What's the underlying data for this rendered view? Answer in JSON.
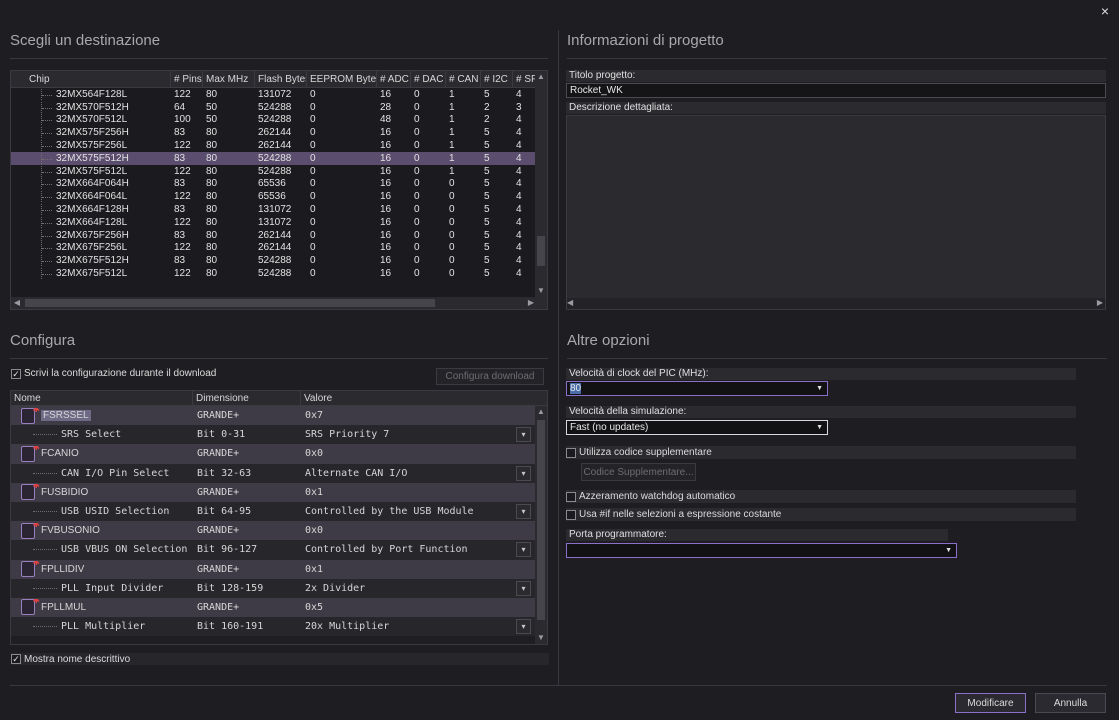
{
  "window": {
    "close_glyph": "×"
  },
  "destination": {
    "title": "Scegli un destinazione",
    "columns": [
      "Chip",
      "# Pins",
      "Max MHz",
      "Flash Bytes",
      "EEPROM Bytes",
      "# ADC",
      "# DAC",
      "# CAN",
      "# I2C",
      "# SP"
    ],
    "rows": [
      [
        "32MX564F128L",
        "122",
        "80",
        "131072",
        "0",
        "16",
        "0",
        "1",
        "5",
        "4"
      ],
      [
        "32MX570F512H",
        "64",
        "50",
        "524288",
        "0",
        "28",
        "0",
        "1",
        "2",
        "3"
      ],
      [
        "32MX570F512L",
        "100",
        "50",
        "524288",
        "0",
        "48",
        "0",
        "1",
        "2",
        "4"
      ],
      [
        "32MX575F256H",
        "83",
        "80",
        "262144",
        "0",
        "16",
        "0",
        "1",
        "5",
        "4"
      ],
      [
        "32MX575F256L",
        "122",
        "80",
        "262144",
        "0",
        "16",
        "0",
        "1",
        "5",
        "4"
      ],
      [
        "32MX575F512H",
        "83",
        "80",
        "524288",
        "0",
        "16",
        "0",
        "1",
        "5",
        "4"
      ],
      [
        "32MX575F512L",
        "122",
        "80",
        "524288",
        "0",
        "16",
        "0",
        "1",
        "5",
        "4"
      ],
      [
        "32MX664F064H",
        "83",
        "80",
        "65536",
        "0",
        "16",
        "0",
        "0",
        "5",
        "4"
      ],
      [
        "32MX664F064L",
        "122",
        "80",
        "65536",
        "0",
        "16",
        "0",
        "0",
        "5",
        "4"
      ],
      [
        "32MX664F128H",
        "83",
        "80",
        "131072",
        "0",
        "16",
        "0",
        "0",
        "5",
        "4"
      ],
      [
        "32MX664F128L",
        "122",
        "80",
        "131072",
        "0",
        "16",
        "0",
        "0",
        "5",
        "4"
      ],
      [
        "32MX675F256H",
        "83",
        "80",
        "262144",
        "0",
        "16",
        "0",
        "0",
        "5",
        "4"
      ],
      [
        "32MX675F256L",
        "122",
        "80",
        "262144",
        "0",
        "16",
        "0",
        "0",
        "5",
        "4"
      ],
      [
        "32MX675F512H",
        "83",
        "80",
        "524288",
        "0",
        "16",
        "0",
        "0",
        "5",
        "4"
      ],
      [
        "32MX675F512L",
        "122",
        "80",
        "524288",
        "0",
        "16",
        "0",
        "0",
        "5",
        "4"
      ]
    ],
    "selected_row": 5
  },
  "project_info": {
    "title": "Informazioni di progetto",
    "project_title_label": "Titolo progetto:",
    "project_title_value": "Rocket_WK",
    "description_label": "Descrizione dettagliata:",
    "description_value": ""
  },
  "configure": {
    "title": "Configura",
    "write_config_label": "Scrivi la configurazione durante il download",
    "write_config_checked": true,
    "config_download_button": "Configura download",
    "columns": [
      "Nome",
      "Dimensione",
      "Valore"
    ],
    "rows": [
      {
        "type": "reg",
        "name": "FSRSSEL",
        "size": "GRANDE+",
        "value": "0x7"
      },
      {
        "type": "field",
        "name": "SRS Select",
        "size": "Bit 0-31",
        "value": "SRS Priority 7"
      },
      {
        "type": "reg",
        "name": "FCANIO",
        "size": "GRANDE+",
        "value": "0x0"
      },
      {
        "type": "field",
        "name": "CAN I/O Pin Select",
        "size": "Bit 32-63",
        "value": "Alternate CAN I/O"
      },
      {
        "type": "reg",
        "name": "FUSBIDIO",
        "size": "GRANDE+",
        "value": "0x1"
      },
      {
        "type": "field",
        "name": "USB USID Selection",
        "size": "Bit 64-95",
        "value": "Controlled by the USB Module"
      },
      {
        "type": "reg",
        "name": "FVBUSONIO",
        "size": "GRANDE+",
        "value": "0x0"
      },
      {
        "type": "field",
        "name": "USB VBUS ON Selection",
        "size": "Bit 96-127",
        "value": "Controlled by Port Function"
      },
      {
        "type": "reg",
        "name": "FPLLIDIV",
        "size": "GRANDE+",
        "value": "0x1"
      },
      {
        "type": "field",
        "name": "PLL Input Divider",
        "size": "Bit 128-159",
        "value": "2x Divider"
      },
      {
        "type": "reg",
        "name": "FPLLMUL",
        "size": "GRANDE+",
        "value": "0x5"
      },
      {
        "type": "field",
        "name": "PLL Multiplier",
        "size": "Bit 160-191",
        "value": "20x Multiplier"
      }
    ],
    "show_descriptive_label": "Mostra nome descrittivo",
    "show_descriptive_checked": true
  },
  "other_options": {
    "title": "Altre opzioni",
    "clock_label": "Velocità di clock del PIC (MHz):",
    "clock_value": "80",
    "sim_speed_label": "Velocità della simulazione:",
    "sim_speed_value": "Fast (no updates)",
    "use_extra_code_label": "Utilizza codice supplementare",
    "extra_code_button": "Codice Supplementare...",
    "watchdog_label": "Azzeramento watchdog automatico",
    "ifdef_label": "Usa #if nelle selezioni a espressione costante",
    "programmer_port_label": "Porta programmatore:",
    "programmer_port_value": ""
  },
  "footer": {
    "modify_button": "Modificare",
    "cancel_button": "Annulla"
  }
}
